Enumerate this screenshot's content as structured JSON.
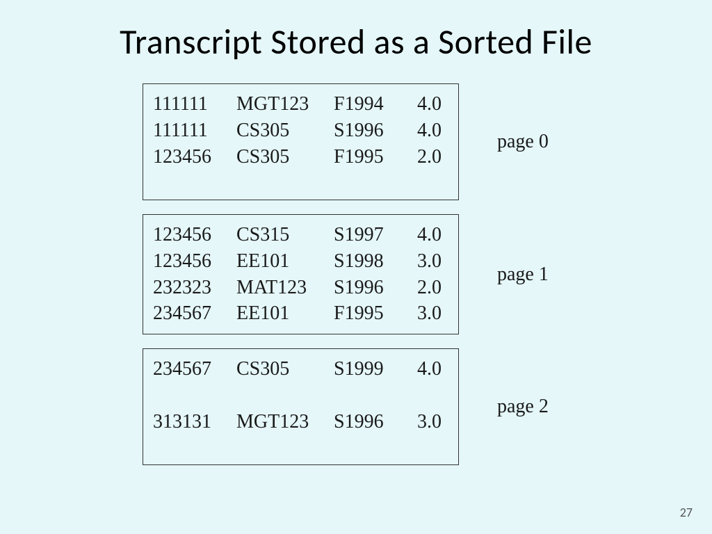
{
  "title": "Transcript Stored as a Sorted File",
  "slide_number": "27",
  "pages": [
    {
      "label": "page 0",
      "records": [
        {
          "id": "111111",
          "course": "MGT123",
          "term": "F1994",
          "grade": "4.0"
        },
        {
          "id": "111111",
          "course": "CS305",
          "term": "S1996",
          "grade": "4.0"
        },
        {
          "id": "123456",
          "course": "CS305",
          "term": "F1995",
          "grade": "2.0"
        }
      ]
    },
    {
      "label": "page 1",
      "records": [
        {
          "id": "123456",
          "course": "CS315",
          "term": "S1997",
          "grade": "4.0"
        },
        {
          "id": "123456",
          "course": "EE101",
          "term": "S1998",
          "grade": "3.0"
        },
        {
          "id": "232323",
          "course": "MAT123",
          "term": "S1996",
          "grade": "2.0"
        },
        {
          "id": "234567",
          "course": "EE101",
          "term": "F1995",
          "grade": "3.0"
        }
      ]
    },
    {
      "label": "page 2",
      "records": [
        {
          "id": "234567",
          "course": "CS305",
          "term": "S1999",
          "grade": "4.0"
        },
        null,
        {
          "id": "313131",
          "course": "MGT123",
          "term": "S1996",
          "grade": "3.0"
        }
      ]
    }
  ]
}
